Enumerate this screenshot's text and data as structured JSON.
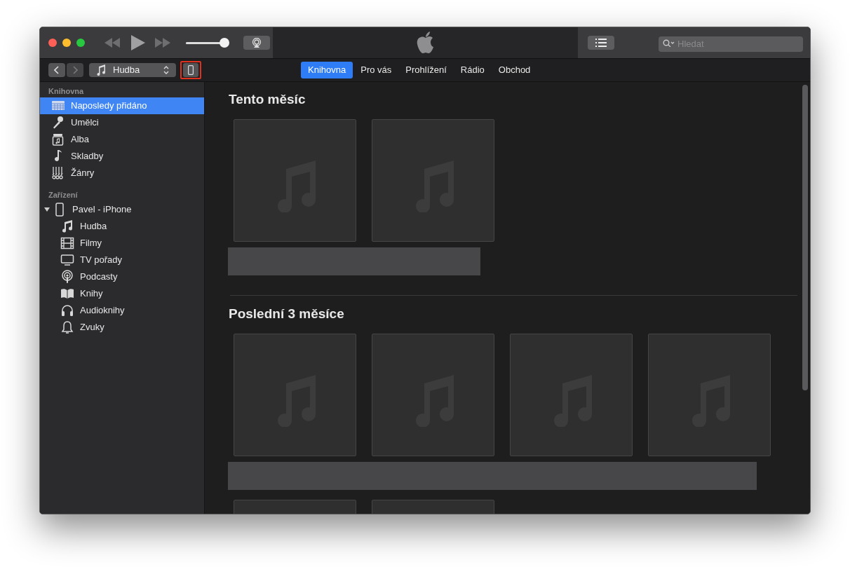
{
  "toolbar": {
    "volume": {
      "level": 0.95
    },
    "search": {
      "placeholder": "Hledat"
    }
  },
  "navbar": {
    "media_picker": "Hudba",
    "device_button": {
      "highlighted": true
    },
    "tabs": [
      {
        "label": "Knihovna",
        "selected": true
      },
      {
        "label": "Pro vás",
        "selected": false
      },
      {
        "label": "Prohlížení",
        "selected": false
      },
      {
        "label": "Rádio",
        "selected": false
      },
      {
        "label": "Obchod",
        "selected": false
      }
    ]
  },
  "sidebar": {
    "library": {
      "heading": "Knihovna",
      "items": [
        {
          "label": "Naposledy přidáno",
          "selected": true
        },
        {
          "label": "Umělci",
          "selected": false
        },
        {
          "label": "Alba",
          "selected": false
        },
        {
          "label": "Skladby",
          "selected": false
        },
        {
          "label": "Žánry",
          "selected": false
        }
      ]
    },
    "devices": {
      "heading": "Zařízení",
      "items": [
        {
          "label": "Pavel - iPhone",
          "selected": false,
          "expanded": true,
          "children": [
            {
              "label": "Hudba",
              "selected": false
            },
            {
              "label": "Filmy",
              "selected": false
            },
            {
              "label": "TV pořady",
              "selected": false
            },
            {
              "label": "Podcasty",
              "selected": false
            },
            {
              "label": "Knihy",
              "selected": false
            },
            {
              "label": "Audioknihy",
              "selected": false
            },
            {
              "label": "Zvuky",
              "selected": false
            }
          ]
        }
      ]
    }
  },
  "content": {
    "sections": [
      {
        "title": "Tento měsíc",
        "albums": [
          {
            "kind": "placeholder"
          },
          {
            "kind": "placeholder"
          }
        ],
        "caption": {
          "kind": "bar"
        }
      },
      {
        "title": "Poslední 3 měsíce",
        "albums": [
          {
            "kind": "placeholder"
          },
          {
            "kind": "placeholder"
          },
          {
            "kind": "placeholder"
          },
          {
            "kind": "placeholder"
          }
        ],
        "caption": {
          "kind": "bar"
        }
      },
      {
        "albums": [
          {
            "kind": "cut_off"
          },
          {
            "kind": "cut_off"
          }
        ]
      }
    ]
  }
}
